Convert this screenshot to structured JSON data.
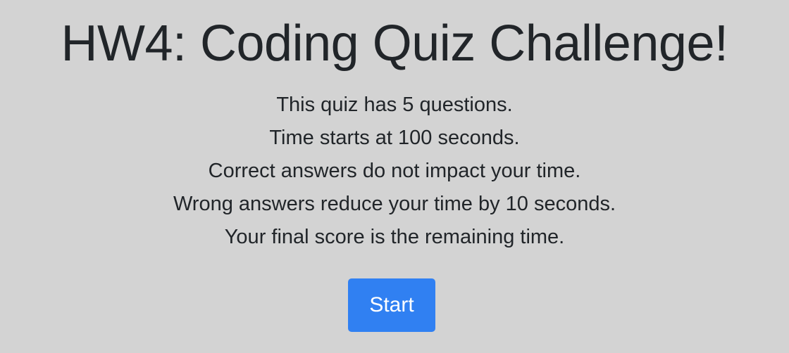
{
  "header": {
    "title": "HW4: Coding Quiz Challenge!"
  },
  "instructions": [
    "This quiz has 5 questions.",
    "Time starts at 100 seconds.",
    "Correct answers do not impact your time.",
    "Wrong answers reduce your time by 10 seconds.",
    "Your final score is the remaining time."
  ],
  "actions": {
    "start_label": "Start"
  },
  "colors": {
    "background": "#d3d3d3",
    "text": "#212529",
    "button": "#3080f2",
    "button_text": "#ffffff"
  }
}
